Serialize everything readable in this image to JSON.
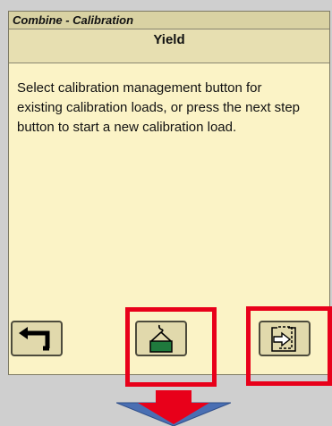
{
  "window": {
    "title": "Combine - Calibration",
    "subtitle": "Yield"
  },
  "message": {
    "text": "Select calibration management button for existing calibration loads, or press the next step button to start a new calibration load."
  },
  "buttons": [
    {
      "name": "back-button",
      "icon": "return-arrow-icon"
    },
    {
      "name": "calibration-management-button",
      "icon": "hanging-load-icon"
    },
    {
      "name": "next-step-button",
      "icon": "next-page-arrow-icon"
    }
  ],
  "colors": {
    "panel_background": "#fbf3c6",
    "title_bar": "#d9d2a3",
    "button_face": "#e1d9ac",
    "load_icon_fill": "#1f7a3d",
    "highlight": "#e8001a",
    "arrow_blue": "#4a6fb3"
  }
}
